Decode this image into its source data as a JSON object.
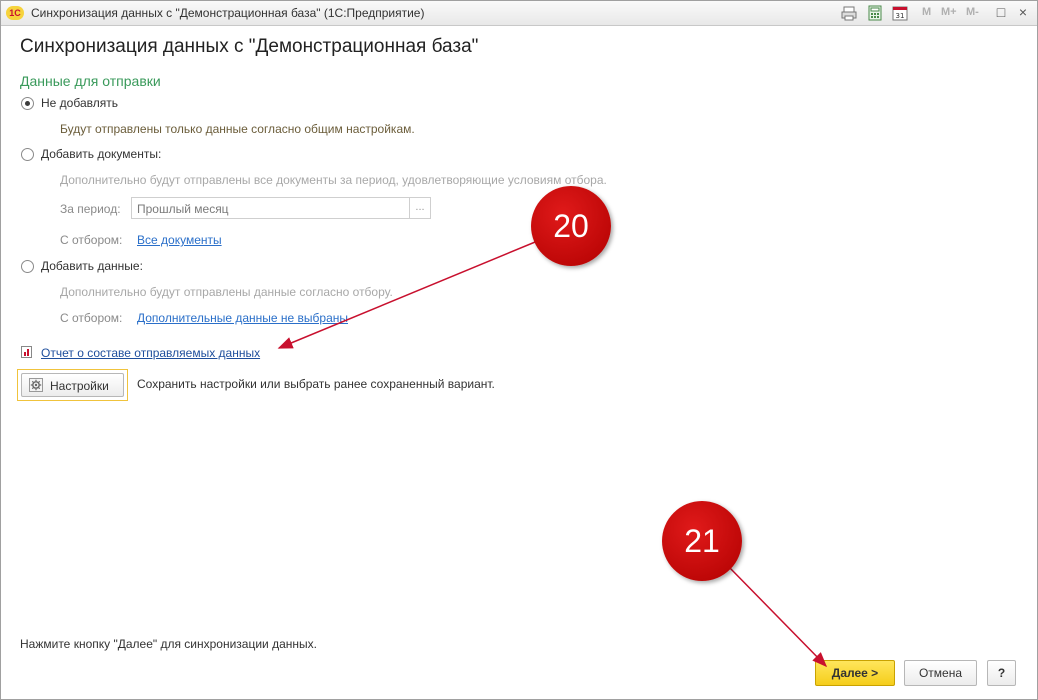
{
  "window": {
    "app_logo": "1С",
    "title": "Синхронизация данных с \"Демонстрационная база\"  (1С:Предприятие)",
    "toolbar": {
      "m": "M",
      "m_plus": "M+",
      "m_minus": "M-",
      "maximize": "□",
      "close": "×"
    }
  },
  "form": {
    "title": "Синхронизация данных с \"Демонстрационная база\"",
    "section_title": "Данные для отправки",
    "options": [
      {
        "label": "Не добавлять",
        "selected": true,
        "hint": "Будут отправлены только данные согласно общим настройкам."
      },
      {
        "label": "Добавить документы:",
        "selected": false,
        "hint": "Дополнительно будут отправлены все документы за период, удовлетворяющие условиям отбора."
      },
      {
        "label": "Добавить данные:",
        "selected": false,
        "hint": "Дополнительно будут отправлены данные согласно отбору."
      }
    ],
    "period": {
      "label": "За период:",
      "value": "Прошлый месяц",
      "select_button": "..."
    },
    "documents_filter": {
      "label": "С отбором:",
      "link": "Все документы"
    },
    "data_filter": {
      "label": "С отбором:",
      "link": "Дополнительные данные не выбраны"
    },
    "report_link": "Отчет о составе отправляемых данных",
    "settings": {
      "button": "Настройки",
      "description": "Сохранить настройки или выбрать ранее сохраненный вариант."
    },
    "footer_hint": "Нажмите кнопку \"Далее\" для синхронизации данных.",
    "buttons": {
      "next": "Далее >",
      "cancel": "Отмена",
      "help": "?"
    }
  },
  "callouts": [
    {
      "number": "20",
      "color": "#c8102e"
    },
    {
      "number": "21",
      "color": "#c8102e"
    }
  ],
  "colors": {
    "accent_green": "#3a9a5b",
    "link_blue": "#2a6fc9",
    "default_button": "#f5cd1a",
    "callout_red": "#c8102e"
  }
}
